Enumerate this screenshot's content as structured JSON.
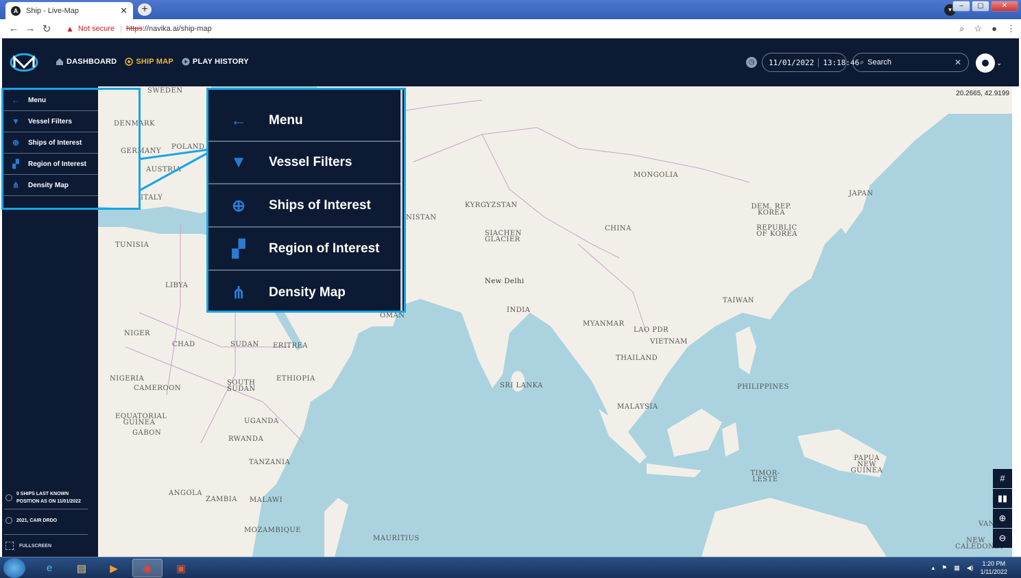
{
  "browser": {
    "tab_title": "Ship - Live-Map",
    "tab_close": "✕",
    "new_tab": "+",
    "not_secure": "Not secure",
    "url_scheme": "https",
    "url_rest": "://navika.ai/ship-map"
  },
  "header": {
    "nav": [
      {
        "label": "DASHBOARD",
        "icon": "home-icon",
        "active": false
      },
      {
        "label": "SHIP MAP",
        "icon": "target-icon",
        "active": true
      },
      {
        "label": "PLAY HISTORY",
        "icon": "play-icon",
        "active": false
      }
    ],
    "date": "11/01/2022",
    "time": "13:18:46",
    "search_placeholder": "Search"
  },
  "sidebar": {
    "items": [
      {
        "label": "Menu",
        "icon": "arrow-left-icon"
      },
      {
        "label": "Vessel Filters",
        "icon": "funnel-icon"
      },
      {
        "label": "Ships of Interest",
        "icon": "crosshair-icon"
      },
      {
        "label": "Region of Interest",
        "icon": "region-icon"
      },
      {
        "label": "Density Map",
        "icon": "network-icon"
      }
    ],
    "status_line1": "0 SHIPS LAST KNOWN",
    "status_line2": "POSITION AS ON 11/01/2022",
    "copyright": "2021, CAIR DRDO",
    "fullscreen": "FULLSCREEN"
  },
  "map": {
    "coords": "20.2665, 42.9199",
    "labels": [
      "SWEDEN",
      "DENMARK",
      "GERMANY",
      "POLAND",
      "AUSTRIA",
      "ITALY",
      "TUNISIA",
      "LIBYA",
      "NIGER",
      "CHAD",
      "SUDAN",
      "ERITREA",
      "NIGERIA",
      "CAMEROON",
      "SOUTH SUDAN",
      "ETHIOPIA",
      "EQUATORIAL GUINEA",
      "GABON",
      "UGANDA",
      "RWANDA",
      "TANZANIA",
      "ANGOLA",
      "ZAMBIA",
      "MALAWI",
      "MOZAMBIQUE",
      "MAURITIUS",
      "OMAN",
      "KYRGYZSTAN",
      "NISTAN",
      "SIACHEN GLACIER",
      "New Delhi",
      "INDIA",
      "SRI LANKA",
      "MONGOLIA",
      "CHINA",
      "DEM. REP. KOREA",
      "REPUBLIC OF KOREA",
      "JAPAN",
      "TAIWAN",
      "MYANMAR",
      "LAO PDR",
      "VIETNAM",
      "THAILAND",
      "PHILIPPINES",
      "MALAYSIA",
      "PAPUA NEW GUINEA",
      "TIMOR-LESTE",
      "VAN",
      "NEW CALEDONIA"
    ],
    "controls": [
      "#",
      "▮▮",
      "⊕",
      "⊖"
    ]
  },
  "taskbar": {
    "time": "1:20 PM",
    "date": "1/11/2022"
  },
  "colors": {
    "navy": "#0c1a33",
    "accent": "#f2b632",
    "highlight": "#16a5e6",
    "icon_blue": "#2a7bd1",
    "sea": "#aad3df",
    "land": "#f2efe9"
  }
}
